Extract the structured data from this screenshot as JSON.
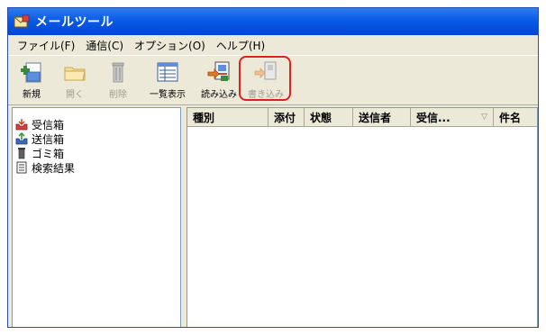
{
  "window": {
    "title": "メールツール"
  },
  "menu": [
    "ファイル(F)",
    "通信(C)",
    "オプション(O)",
    "ヘルプ(H)"
  ],
  "toolbar": {
    "new_label": "新規",
    "open_label": "開く",
    "delete_label": "削除",
    "list_label": "一覧表示",
    "read_label": "読み込み",
    "write_label": "書き込み"
  },
  "tree": [
    "受信箱",
    "送信箱",
    "ゴミ箱",
    "検索結果"
  ],
  "columns": [
    "種別",
    "添付",
    "状態",
    "送信者",
    "受信...",
    "件名"
  ],
  "colors": {
    "title_bar": "#0a5be6",
    "highlight": "#e01f1f"
  }
}
